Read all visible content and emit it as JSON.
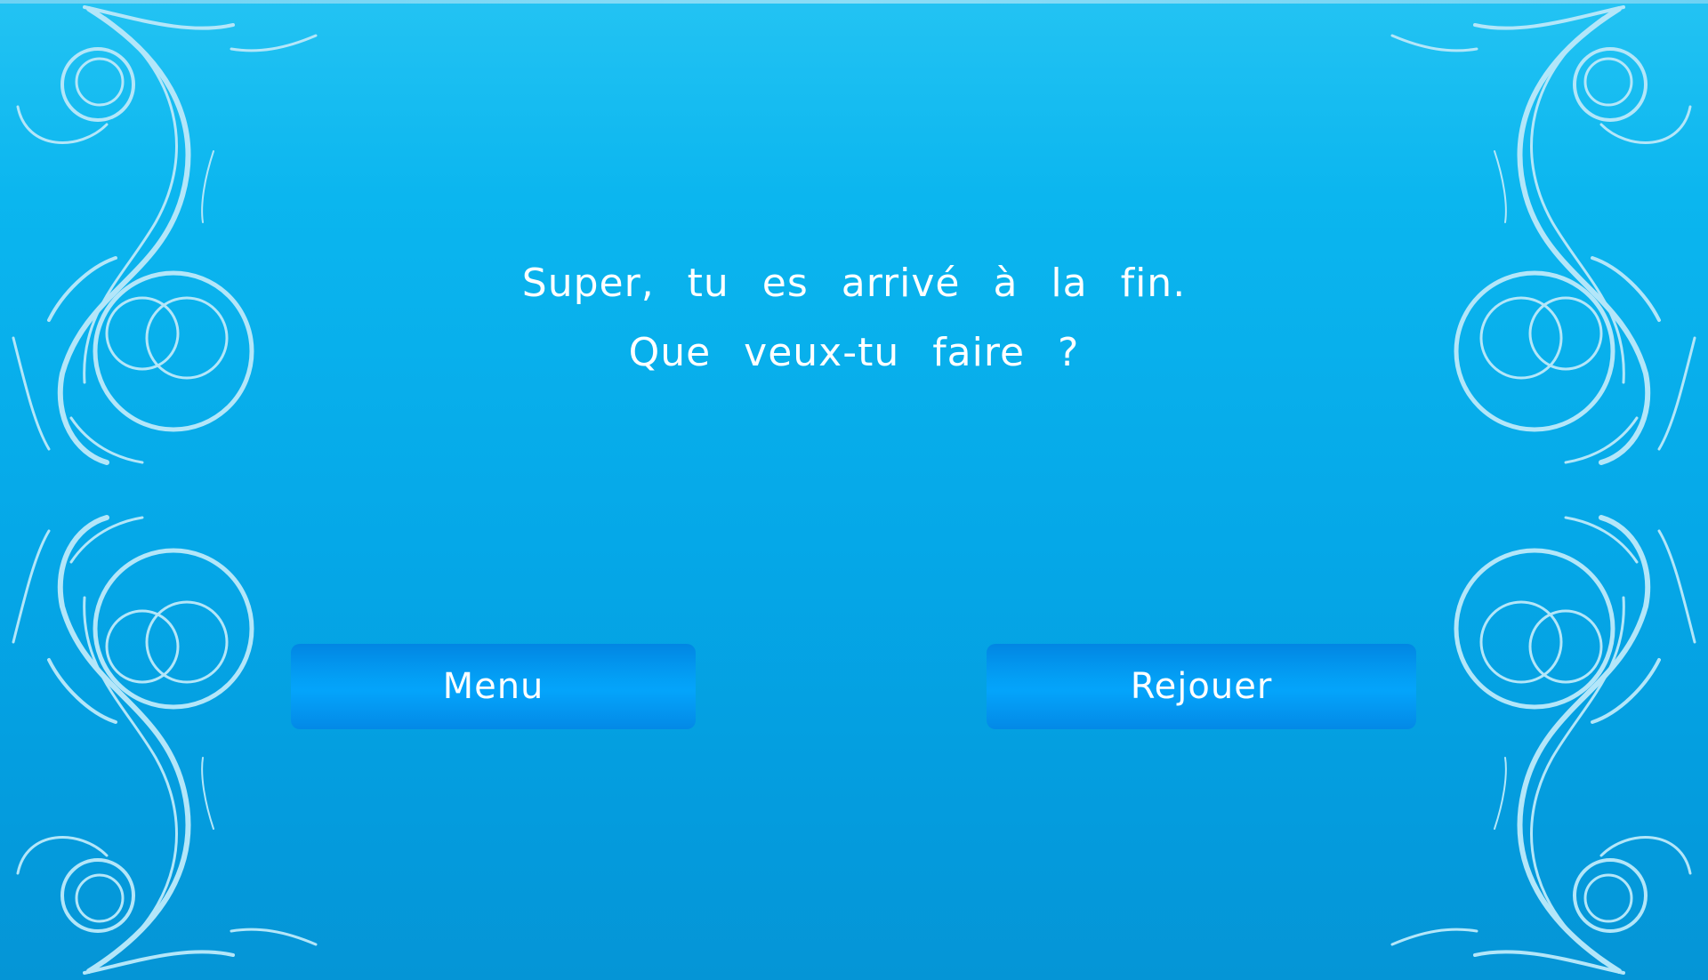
{
  "message": {
    "line1": "Super, tu es arrivé à la fin.",
    "line2": "Que veux-tu faire ?"
  },
  "buttons": {
    "menu_label": "Menu",
    "replay_label": "Rejouer"
  },
  "colors": {
    "background_top": "#23c3f3",
    "background_bottom": "#0595d6",
    "button": "#039ff5",
    "ornament": "#b3e6f9",
    "text": "#ffffff"
  }
}
